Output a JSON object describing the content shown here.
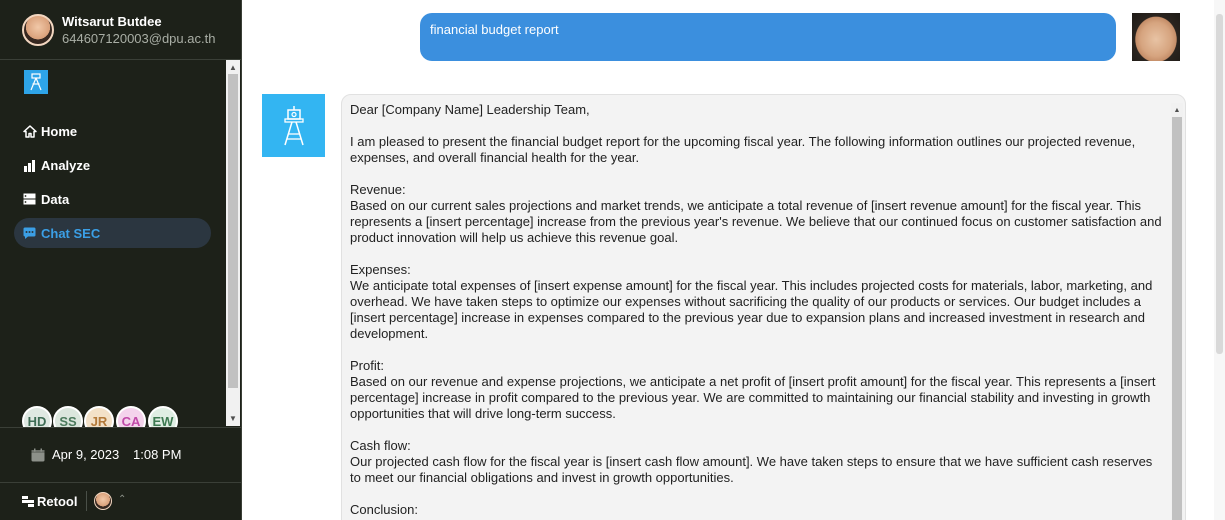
{
  "sidebar": {
    "user": {
      "name": "Witsarut Butdee",
      "email": "644607120003@dpu.ac.th"
    },
    "nav": [
      {
        "label": "Home",
        "icon": "home-icon",
        "active": false
      },
      {
        "label": "Analyze",
        "icon": "bar-chart-icon",
        "active": false
      },
      {
        "label": "Data",
        "icon": "database-icon",
        "active": false
      },
      {
        "label": "Chat SEC",
        "icon": "chat-icon",
        "active": true
      }
    ],
    "avatars": [
      {
        "initials": "HD",
        "bg": "#dfe8e2",
        "fg": "#3e6c55"
      },
      {
        "initials": "SS",
        "bg": "#dbe6dd",
        "fg": "#4c7a5d"
      },
      {
        "initials": "JR",
        "bg": "#f3e1c8",
        "fg": "#b47a3a"
      },
      {
        "initials": "CA",
        "bg": "#f4d3ec",
        "fg": "#c14aa8"
      },
      {
        "initials": "EW",
        "bg": "#dfeee3",
        "fg": "#3e7a52"
      }
    ],
    "date": "Apr 9, 2023",
    "time": "1:08 PM",
    "footer_brand": "Retool"
  },
  "chat": {
    "user_message": "financial budget report",
    "bot_message": "Dear [Company Name] Leadership Team,\n\nI am pleased to present the financial budget report for the upcoming fiscal year. The following information outlines our projected revenue, expenses, and overall financial health for the year.\n\nRevenue:\nBased on our current sales projections and market trends, we anticipate a total revenue of [insert revenue amount] for the fiscal year. This represents a [insert percentage] increase from the previous year's revenue. We believe that our continued focus on customer satisfaction and product innovation will help us achieve this revenue goal.\n\nExpenses:\nWe anticipate total expenses of [insert expense amount] for the fiscal year. This includes projected costs for materials, labor, marketing, and overhead. We have taken steps to optimize our expenses without sacrificing the quality of our products or services. Our budget includes a [insert percentage] increase in expenses compared to the previous year due to expansion plans and increased investment in research and development.\n\nProfit:\nBased on our revenue and expense projections, we anticipate a net profit of [insert profit amount] for the fiscal year. This represents a [insert percentage] increase in profit compared to the previous year. We are committed to maintaining our financial stability and investing in growth opportunities that will drive long-term success.\n\nCash flow:\nOur projected cash flow for the fiscal year is [insert cash flow amount]. We have taken steps to ensure that we have sufficient cash reserves to meet our financial obligations and invest in growth opportunities.\n\nConclusion:"
  },
  "colors": {
    "sidebar_bg": "#1d2119",
    "accent": "#3b8fde",
    "active_nav_text": "#3b9fe6",
    "bot_logo_bg": "#33b5f2"
  }
}
